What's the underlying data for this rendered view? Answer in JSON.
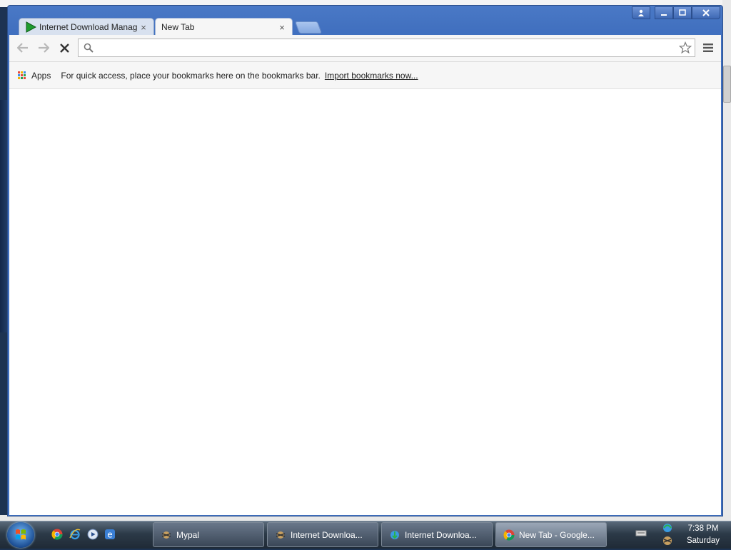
{
  "browser": {
    "tabs": [
      {
        "title": "Internet Download Manag",
        "close": "×",
        "active": false
      },
      {
        "title": "New Tab",
        "close": "×",
        "active": true
      }
    ],
    "toolbar": {
      "address_value": "",
      "icons": [
        "back-icon",
        "forward-icon",
        "stop-icon",
        "search-icon",
        "star-icon",
        "menu-icon"
      ]
    },
    "bookmarks_bar": {
      "apps_label": "Apps",
      "hint_text": "For quick access, place your bookmarks here on the bookmarks bar.",
      "import_link": "Import bookmarks now..."
    }
  },
  "taskbar": {
    "tasks": [
      {
        "label": "Mypal",
        "active": false
      },
      {
        "label": "Internet Downloa...",
        "active": false
      },
      {
        "label": "Internet Downloa...",
        "active": false
      },
      {
        "label": "New Tab - Google...",
        "active": true
      }
    ],
    "clock": {
      "time": "7:38 PM",
      "day": "Saturday"
    }
  },
  "colors": {
    "window_frame": "#4271c0",
    "toolbar_bg": "#f6f6f6",
    "taskbar_bg": "#2c3a48"
  }
}
